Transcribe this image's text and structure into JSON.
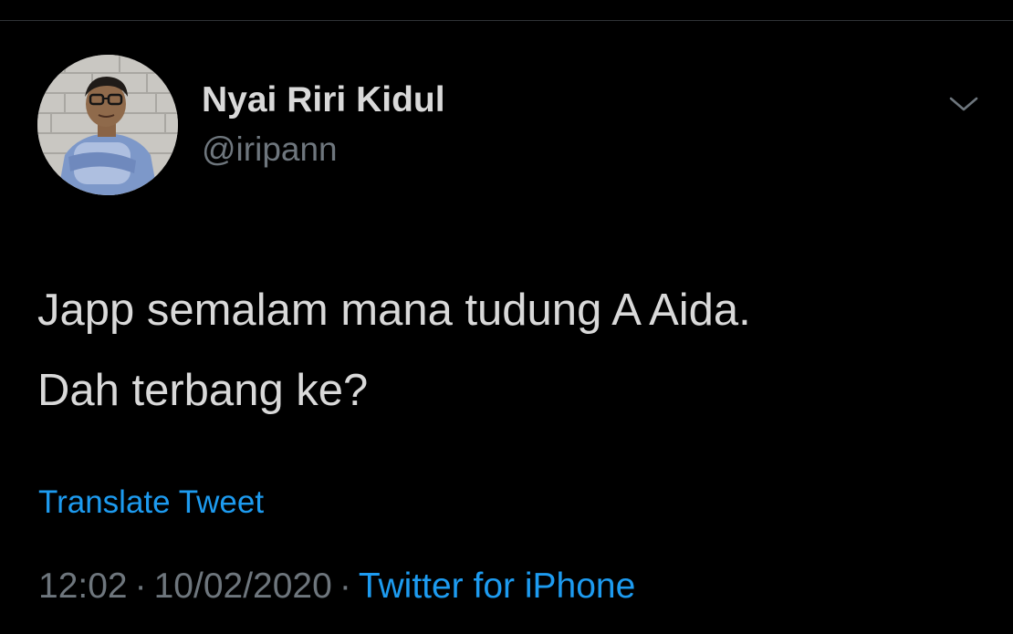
{
  "tweet": {
    "author": {
      "display_name": "Nyai Riri Kidul",
      "handle": "@iripann",
      "avatar": "profile-photo"
    },
    "menu_icon": "chevron-down-icon",
    "text_lines": [
      "Japp semalam mana tudung A Aida.",
      "Dah terbang ke?"
    ],
    "translate_label": "Translate Tweet",
    "time": "12:02",
    "date": "10/02/2020",
    "separator": "·",
    "source": "Twitter for iPhone"
  },
  "colors": {
    "background": "#000000",
    "primary_text": "#d9d9d9",
    "secondary_text": "#6e767d",
    "accent": "#1d9bf0",
    "divider": "#2f3336"
  }
}
